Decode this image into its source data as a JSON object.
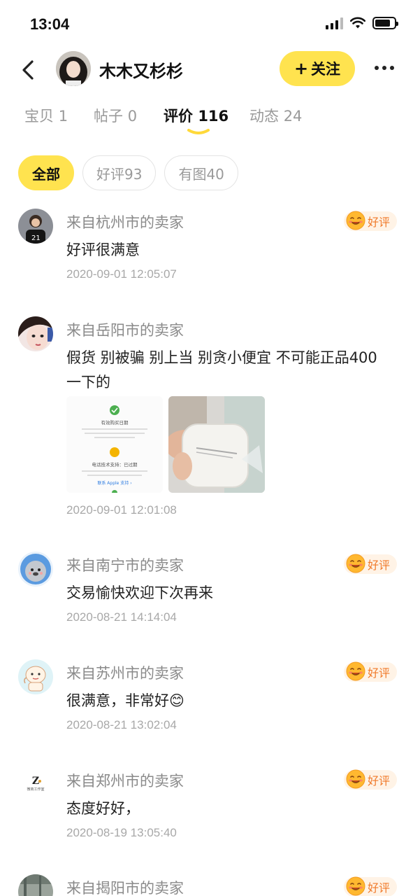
{
  "status_bar": {
    "time": "13:04"
  },
  "header": {
    "username": "木木又杉杉",
    "follow_label": "关注",
    "follow_plus": "+"
  },
  "tabs": [
    {
      "label": "宝贝",
      "count": "1"
    },
    {
      "label": "帖子",
      "count": "0"
    },
    {
      "label": "评价",
      "count": "116",
      "active": true
    },
    {
      "label": "动态",
      "count": "24"
    }
  ],
  "filters": [
    {
      "label": "全部",
      "active": true
    },
    {
      "label": "好评93"
    },
    {
      "label": "有图40"
    }
  ],
  "badge_label": "好评",
  "reviews": [
    {
      "source": "来自杭州市的卖家",
      "text": "好评很满意",
      "date": "2020-09-01 12:05:07",
      "badge": true,
      "avatar": "avatar-boy-21"
    },
    {
      "source": "来自岳阳市的卖家",
      "text": "假货  别被骗  别上当 别贪小便宜  不可能正品400一下的",
      "date": "2020-09-01 12:01:08",
      "badge": false,
      "avatar": "avatar-girl",
      "screenshot_lines": [
        "有效购买日期",
        "电话技术支持：已过期",
        "联系 Apple 支持 ›"
      ]
    },
    {
      "source": "来自南宁市的卖家",
      "text": "交易愉快欢迎下次再来",
      "date": "2020-08-21 14:14:04",
      "badge": true,
      "avatar": "avatar-seal"
    },
    {
      "source": "来自苏州市的卖家",
      "text": "很满意，非常好😊",
      "date": "2020-08-21 13:02:04",
      "badge": true,
      "avatar": "avatar-cartoon"
    },
    {
      "source": "来自郑州市的卖家",
      "text": "态度好好，",
      "date": "2020-08-19 13:05:40",
      "badge": true,
      "avatar": "avatar-logo",
      "logo_text": "Z",
      "logo_subtext": "微商工作室"
    },
    {
      "source": "来自揭阳市的卖家",
      "text": "",
      "date": "",
      "badge": true,
      "avatar": "avatar-photo"
    }
  ],
  "colors": {
    "accent": "#FFE34F",
    "badge_text": "#F07A2A",
    "badge_bg": "#FFF3E6",
    "muted": "#9a9a9a"
  }
}
